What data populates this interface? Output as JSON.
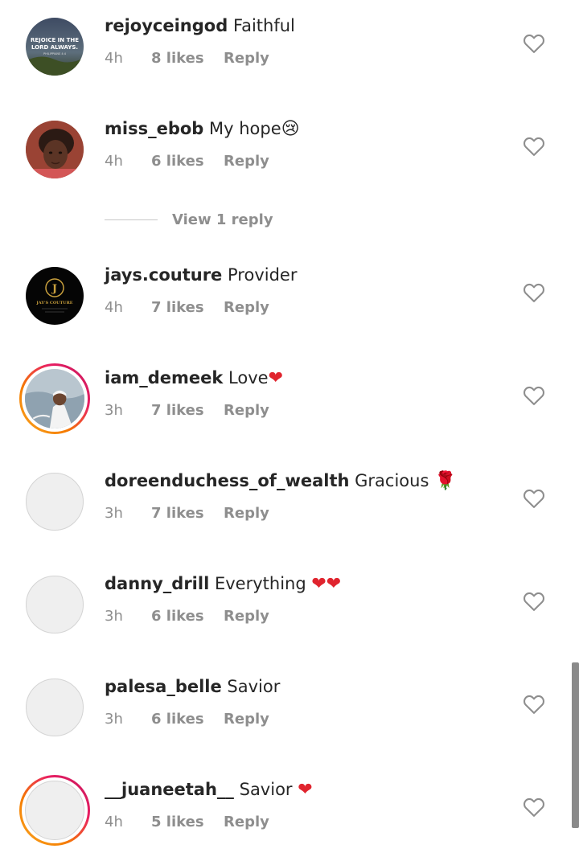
{
  "comments": [
    {
      "username": "rejoyceingod",
      "text": "Faithful",
      "emoji": "",
      "time": "4h",
      "likes": "8 likes",
      "reply": "Reply",
      "avatar_text": "REJOICE IN THE LORD ALWAYS."
    },
    {
      "username": "miss_ebob",
      "text": "My hope",
      "emoji": "😢",
      "time": "4h",
      "likes": "6 likes",
      "reply": "Reply"
    },
    {
      "username": "jays.couture",
      "text": "Provider",
      "emoji": "",
      "time": "4h",
      "likes": "7 likes",
      "reply": "Reply",
      "avatar_text": "JAY'S COUTURE"
    },
    {
      "username": "iam_demeek",
      "text": "Love",
      "emoji": "❤",
      "time": "3h",
      "likes": "7 likes",
      "reply": "Reply"
    },
    {
      "username": "doreenduchess_of_wealth",
      "text": "Gracious",
      "emoji": "🌹",
      "time": "3h",
      "likes": "7 likes",
      "reply": "Reply"
    },
    {
      "username": "danny_drill",
      "text": "Everything",
      "emoji": "❤❤",
      "time": "3h",
      "likes": "6 likes",
      "reply": "Reply"
    },
    {
      "username": "palesa_belle",
      "text": "Savior",
      "emoji": "",
      "time": "3h",
      "likes": "6 likes",
      "reply": "Reply"
    },
    {
      "username": "__juaneetah__",
      "text": "Savior",
      "emoji": "❤",
      "time": "4h",
      "likes": "5 likes",
      "reply": "Reply"
    }
  ],
  "view_replies": "View 1 reply",
  "colors": {
    "heart_red": "#e0242e",
    "muted": "#8e8e8e",
    "text": "#262626"
  }
}
